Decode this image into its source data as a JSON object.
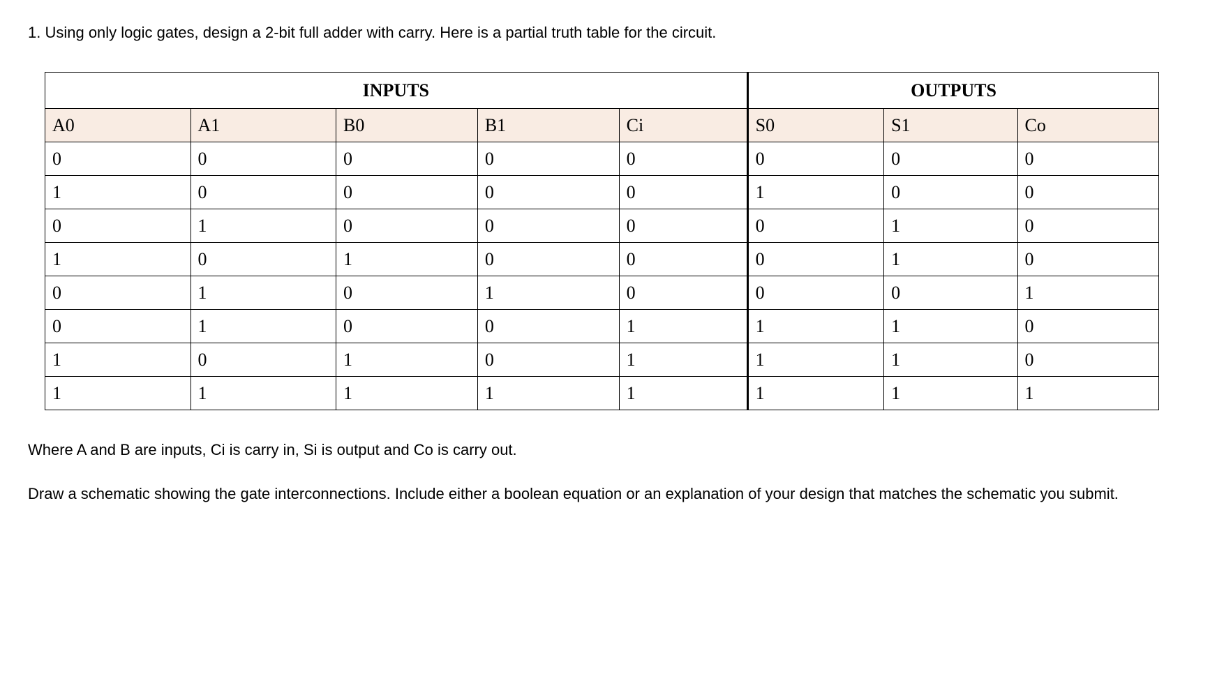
{
  "question": "1. Using only logic gates, design a 2-bit full adder with carry. Here is a partial truth table for the circuit.",
  "table": {
    "group_headers": {
      "inputs": "INPUTS",
      "outputs": "OUTPUTS"
    },
    "columns": [
      "A0",
      "A1",
      "B0",
      "B1",
      "Ci",
      "S0",
      "S1",
      "Co"
    ],
    "rows": [
      [
        "0",
        "0",
        "0",
        "0",
        "0",
        "0",
        "0",
        "0"
      ],
      [
        "1",
        "0",
        "0",
        "0",
        "0",
        "1",
        "0",
        "0"
      ],
      [
        "0",
        "1",
        "0",
        "0",
        "0",
        "0",
        "1",
        "0"
      ],
      [
        "1",
        "0",
        "1",
        "0",
        "0",
        "0",
        "1",
        "0"
      ],
      [
        "0",
        "1",
        "0",
        "1",
        "0",
        "0",
        "0",
        "1"
      ],
      [
        "0",
        "1",
        "0",
        "0",
        "1",
        "1",
        "1",
        "0"
      ],
      [
        "1",
        "0",
        "1",
        "0",
        "1",
        "1",
        "1",
        "0"
      ],
      [
        "1",
        "1",
        "1",
        "1",
        "1",
        "1",
        "1",
        "1"
      ]
    ]
  },
  "description": "Where A and B are inputs, Ci is carry in, Si is output and Co is carry out.",
  "instruction": "Draw a schematic showing the gate interconnections. Include either a boolean equation or an explanation of your design that matches the schematic you submit."
}
